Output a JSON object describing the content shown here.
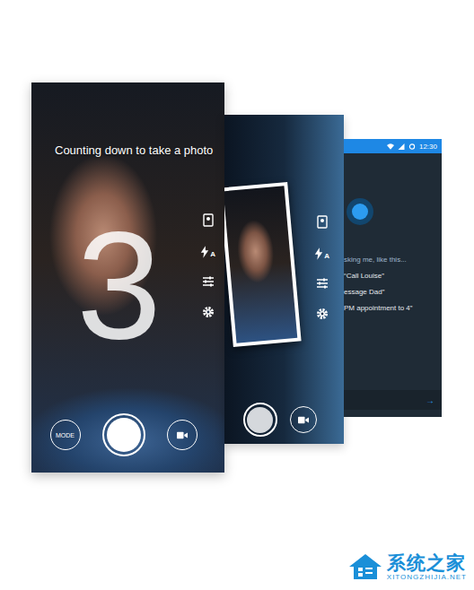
{
  "camera": {
    "caption": "Counting down to take a photo",
    "countdown": "3",
    "flash_mode": "A",
    "mode_button": "MODE"
  },
  "review": {
    "flash_mode": "A"
  },
  "assistant": {
    "status_time": "12:30",
    "prompt": "sking me, like this...",
    "examples": [
      "“Call Louise”",
      "essage Dad”",
      "PM appointment to 4”"
    ],
    "next": "→"
  },
  "watermark": {
    "name": "系统之家",
    "url": "XITONGZHIJIA.NET"
  }
}
